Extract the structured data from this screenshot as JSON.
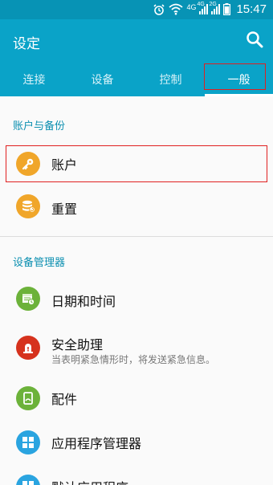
{
  "status_bar": {
    "time": "15:47",
    "signal1_tag": "4G",
    "signal2_tag": "2G",
    "network_label": "4G"
  },
  "header": {
    "title": "设定"
  },
  "tabs": [
    {
      "label": "连接",
      "active": false
    },
    {
      "label": "设备",
      "active": false
    },
    {
      "label": "控制",
      "active": false
    },
    {
      "label": "一般",
      "active": true
    }
  ],
  "sections": [
    {
      "title": "账户与备份",
      "items": [
        {
          "title": "账户",
          "icon": "key-icon",
          "color": "#f0a62a"
        },
        {
          "title": "重置",
          "icon": "reset-icon",
          "color": "#f0a62a"
        }
      ]
    },
    {
      "title": "设备管理器",
      "items": [
        {
          "title": "日期和时间",
          "icon": "calendar-clock-icon",
          "color": "#6cb23a"
        },
        {
          "title": "安全助理",
          "subtitle": "当表明紧急情形时，将发送紧急信息。",
          "icon": "alert-icon",
          "color": "#d6321d"
        },
        {
          "title": "配件",
          "icon": "accessory-icon",
          "color": "#6cb23a"
        },
        {
          "title": "应用程序管理器",
          "icon": "grid-icon",
          "color": "#2aa4e0"
        },
        {
          "title": "默认应用程序",
          "icon": "default-apps-icon",
          "color": "#2aa4e0"
        }
      ]
    }
  ],
  "colors": {
    "appbar": "#0aa3c8",
    "statusbar": "#0793b5",
    "accent": "#0b8fb0",
    "highlight_box": "#e02020"
  }
}
